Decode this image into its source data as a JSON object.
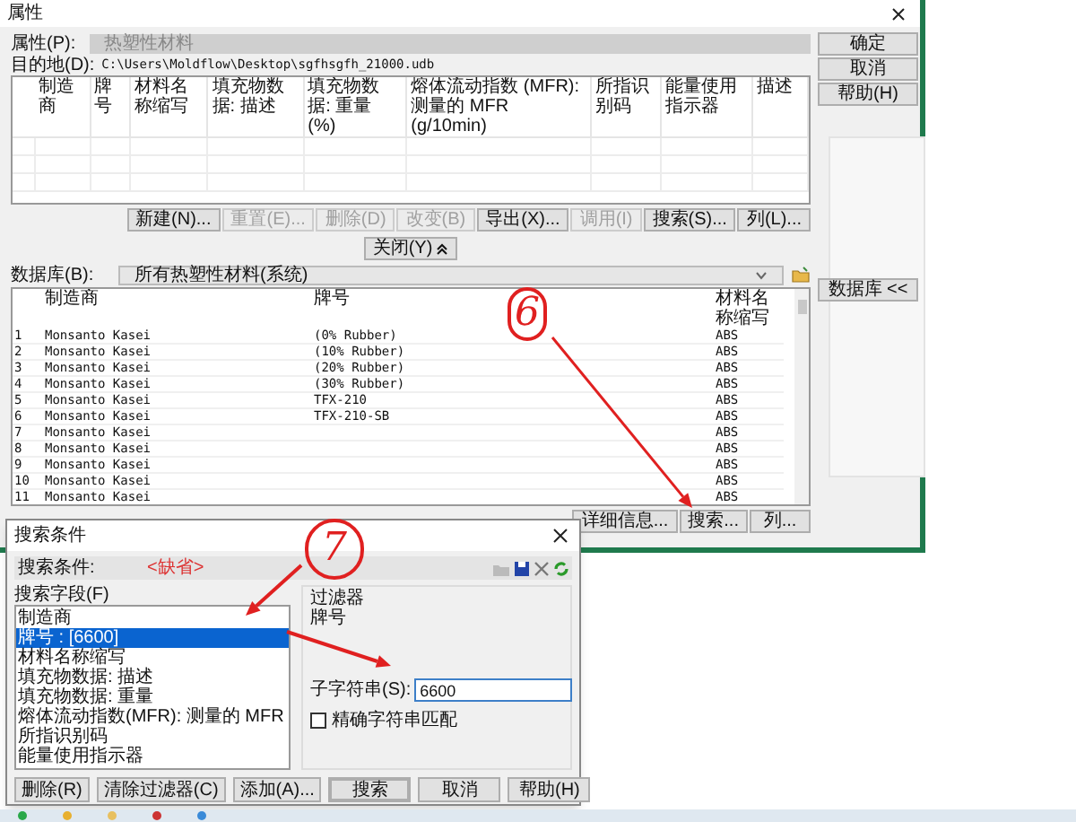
{
  "main_window": {
    "title": "属性",
    "property_label": "属性(P):",
    "property_value": "热塑性材料",
    "destination_label": "目的地(D):",
    "destination_path": "C:\\Users\\Moldflow\\Desktop\\sgfhsgfh_21000.udb",
    "side_buttons": [
      {
        "label": "确定"
      },
      {
        "label": "取消"
      },
      {
        "label": "帮助(H)"
      }
    ],
    "materials_table": {
      "columns": [
        "制造商",
        "牌号",
        "材料名称缩写",
        "填充物数据: 描述",
        "填充物数据: 重量 (%)",
        "熔体流动指数 (MFR): 测量的 MFR (g/10min)",
        "所指识别码",
        "能量使用指示器",
        "描述"
      ]
    },
    "table_buttons": [
      {
        "label": "新建(N)...",
        "disabled": false
      },
      {
        "label": "重置(E)...",
        "disabled": true
      },
      {
        "label": "删除(D)",
        "disabled": true
      },
      {
        "label": "改变(B)",
        "disabled": true
      },
      {
        "label": "导出(X)...",
        "disabled": false
      },
      {
        "label": "调用(I)",
        "disabled": true
      },
      {
        "label": "搜索(S)...",
        "disabled": false
      },
      {
        "label": "列(L)...",
        "disabled": false
      }
    ],
    "database_toggle": "数据库 <<",
    "collapse_button": "关闭(Y)",
    "database_label": "数据库(B):",
    "database_value": "所有热塑性材料(系统)",
    "database_table": {
      "columns": [
        "制造商",
        "牌号",
        "材料名称缩写"
      ],
      "rows": [
        {
          "index": "1",
          "manufacturer": "Monsanto Kasei",
          "grade": "(0% Rubber)",
          "abbreviation": "ABS"
        },
        {
          "index": "2",
          "manufacturer": "Monsanto Kasei",
          "grade": "(10% Rubber)",
          "abbreviation": "ABS"
        },
        {
          "index": "3",
          "manufacturer": "Monsanto Kasei",
          "grade": "(20% Rubber)",
          "abbreviation": "ABS"
        },
        {
          "index": "4",
          "manufacturer": "Monsanto Kasei",
          "grade": "(30% Rubber)",
          "abbreviation": "ABS"
        },
        {
          "index": "5",
          "manufacturer": "Monsanto Kasei",
          "grade": "TFX-210",
          "abbreviation": "ABS"
        },
        {
          "index": "6",
          "manufacturer": "Monsanto Kasei",
          "grade": "TFX-210-SB",
          "abbreviation": "ABS"
        },
        {
          "index": "7",
          "manufacturer": "Monsanto Kasei",
          "abbreviation": "ABS"
        },
        {
          "index": "8",
          "manufacturer": "Monsanto Kasei",
          "abbreviation": "ABS"
        },
        {
          "index": "9",
          "manufacturer": "Monsanto Kasei",
          "abbreviation": "ABS"
        },
        {
          "index": "10",
          "manufacturer": "Monsanto Kasei",
          "abbreviation": "ABS"
        },
        {
          "index": "11",
          "manufacturer": "Monsanto Kasei",
          "abbreviation": "ABS"
        }
      ]
    },
    "bottom_buttons": [
      "详细信息...",
      "搜索...",
      "列..."
    ]
  },
  "search_dialog": {
    "title": "搜索条件",
    "criteria_label": "搜索条件:",
    "criteria_value": "<缺省>",
    "fields_group": "搜索字段(F)",
    "fields": [
      {
        "label": "制造商",
        "selected": false
      },
      {
        "label": "牌号 : [6600]",
        "selected": true
      },
      {
        "label": "材料名称缩写",
        "selected": false
      },
      {
        "label": "填充物数据: 描述",
        "selected": false
      },
      {
        "label": "填充物数据: 重量",
        "selected": false
      },
      {
        "label": "熔体流动指数(MFR): 测量的 MFR",
        "selected": false
      },
      {
        "label": "所指识别码",
        "selected": false
      },
      {
        "label": "能量使用指示器",
        "selected": false
      }
    ],
    "filter_group": "过滤器",
    "filter_field": "牌号",
    "substring_label": "子字符串(S):",
    "substring_value": "6600",
    "exact_match": {
      "label": "精确字符串匹配",
      "checked": false
    },
    "left_buttons": [
      "删除(R)",
      "清除过滤器(C)",
      "添加(A)..."
    ],
    "buttons": [
      {
        "label": "搜索",
        "default": true
      },
      {
        "label": "取消",
        "default": false
      },
      {
        "label": "帮助(H)",
        "default": false
      }
    ]
  },
  "annotations": [
    {
      "label": "6"
    },
    {
      "label": "7"
    }
  ]
}
